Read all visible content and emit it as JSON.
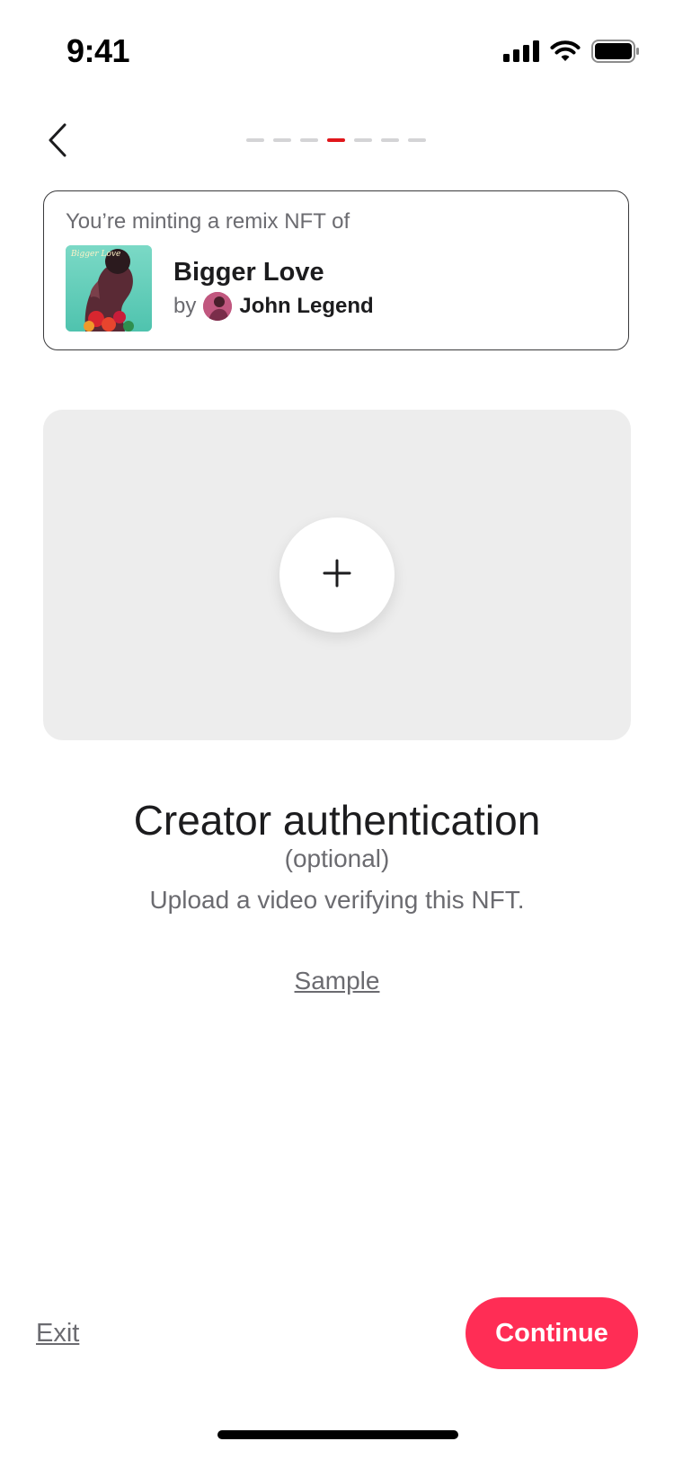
{
  "status_bar": {
    "time": "9:41"
  },
  "progress": {
    "total_steps": 7,
    "current_step": 4,
    "active_color": "#e0161b",
    "inactive_color": "#d4d4d6"
  },
  "mint_card": {
    "intro": "You’re minting a remix NFT of",
    "song_title": "Bigger Love",
    "by_label": "by",
    "artist_name": "John Legend",
    "album_art_icon": "album-cover-image",
    "artist_avatar_icon": "artist-avatar-image"
  },
  "upload": {
    "add_icon": "plus-icon"
  },
  "content": {
    "heading": "Creator authentication",
    "optional_label": "(optional)",
    "subtext": "Upload a video verifying this NFT.",
    "sample_link": "Sample"
  },
  "footer": {
    "exit_label": "Exit",
    "continue_label": "Continue",
    "accent_color": "#ff2d55"
  }
}
